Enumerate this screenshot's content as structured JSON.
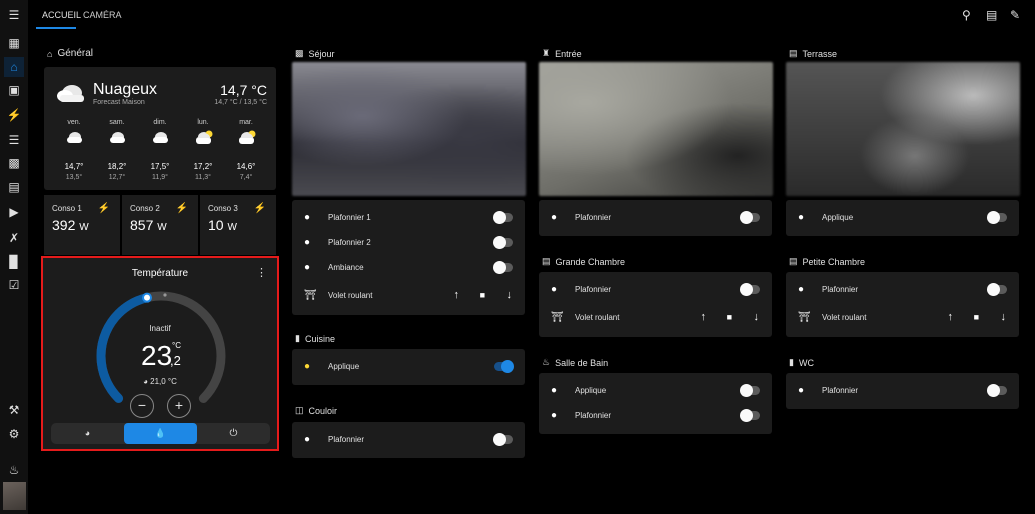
{
  "tabs": [
    "ACCUEIL",
    "CAMÉRA"
  ],
  "sidebar_icons": [
    "menu-icon",
    "dashboard-icon",
    "home-icon",
    "person-board-icon",
    "energy-icon",
    "list-icon",
    "chart-icon",
    "store-icon",
    "media-icon",
    "vscode-icon",
    "terminal-icon",
    "clipboard-icon"
  ],
  "general": {
    "title": "Général"
  },
  "weather": {
    "condition": "Nuageux",
    "source": "Forecast Maison",
    "temp": "14,7 °C",
    "range": "14,7 °C / 13,5 °C",
    "forecast": [
      {
        "day": "ven.",
        "icon": "cloudy",
        "high": "14,7°",
        "low": "13,5°"
      },
      {
        "day": "sam.",
        "icon": "cloudy",
        "high": "18,2°",
        "low": "12,7°"
      },
      {
        "day": "dim.",
        "icon": "cloudy",
        "high": "17,5°",
        "low": "11,9°"
      },
      {
        "day": "lun.",
        "icon": "partly-cloudy",
        "high": "17,2°",
        "low": "11,3°"
      },
      {
        "day": "mar.",
        "icon": "partly-cloudy",
        "high": "14,6°",
        "low": "7,4°"
      }
    ]
  },
  "consos": [
    {
      "name": "Conso 1",
      "value": "392",
      "unit": "W"
    },
    {
      "name": "Conso 2",
      "value": "857",
      "unit": "W"
    },
    {
      "name": "Conso 3",
      "value": "10",
      "unit": "W"
    }
  ],
  "thermostat": {
    "title": "Température",
    "status": "Inactif",
    "temp_int": "23",
    "temp_dec": ",2",
    "unit": "°C",
    "current": "21,0 °C",
    "arc_fraction": 0.45,
    "modes": [
      "auto",
      "heat",
      "off"
    ],
    "active_mode": "heat"
  },
  "colors": {
    "accent": "#1e88e5",
    "on_light": "#fdd835",
    "highlight": "#e51b1b"
  },
  "rooms": {
    "sejour": {
      "title": "Séjour",
      "entities": [
        {
          "name": "Plafonnier 1",
          "type": "light",
          "on": false
        },
        {
          "name": "Plafonnier 2",
          "type": "light",
          "on": false
        },
        {
          "name": "Ambiance",
          "type": "light",
          "on": false
        },
        {
          "name": "Volet roulant",
          "type": "cover"
        }
      ]
    },
    "cuisine": {
      "title": "Cuisine",
      "entities": [
        {
          "name": "Applique",
          "type": "light",
          "on": true
        }
      ]
    },
    "couloir": {
      "title": "Couloir",
      "entities": [
        {
          "name": "Plafonnier",
          "type": "light",
          "on": false
        }
      ]
    },
    "entree": {
      "title": "Entrée",
      "entities": [
        {
          "name": "Plafonnier",
          "type": "light",
          "on": false
        }
      ]
    },
    "grande_chambre": {
      "title": "Grande Chambre",
      "entities": [
        {
          "name": "Plafonnier",
          "type": "light",
          "on": false
        },
        {
          "name": "Volet roulant",
          "type": "cover"
        }
      ]
    },
    "salle_de_bain": {
      "title": "Salle de Bain",
      "entities": [
        {
          "name": "Applique",
          "type": "light",
          "on": false
        },
        {
          "name": "Plafonnier",
          "type": "light",
          "on": false
        }
      ]
    },
    "terrasse": {
      "title": "Terrasse",
      "entities": [
        {
          "name": "Applique",
          "type": "light",
          "on": false
        }
      ]
    },
    "petite_chambre": {
      "title": "Petite Chambre",
      "entities": [
        {
          "name": "Plafonnier",
          "type": "light",
          "on": false
        },
        {
          "name": "Volet roulant",
          "type": "cover"
        }
      ]
    },
    "wc": {
      "title": "WC",
      "entities": [
        {
          "name": "Plafonnier",
          "type": "light",
          "on": false
        }
      ]
    }
  }
}
